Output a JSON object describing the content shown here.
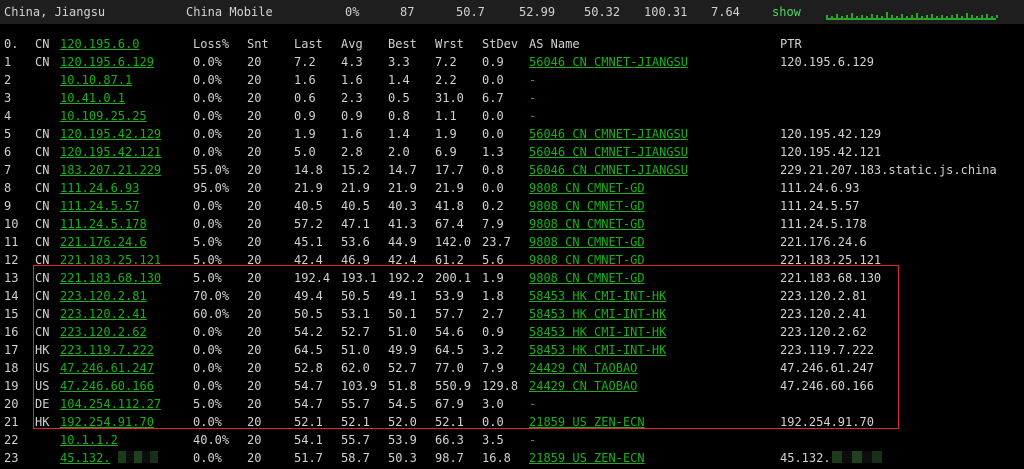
{
  "header": {
    "location": "China, Jiangsu",
    "isp": "China Mobile",
    "loss": "0%",
    "sent": "87",
    "last": "50.7",
    "avg": "52.99",
    "best": "50.32",
    "worst": "100.31",
    "stdev": "7.64",
    "show_label": "show"
  },
  "columns": {
    "hop": "0.",
    "cc": "CN",
    "ip": "120.195.6.0",
    "loss": "Loss%",
    "snt": "Snt",
    "last": "Last",
    "avg": "Avg",
    "best": "Best",
    "wrst": "Wrst",
    "stdev": "StDev",
    "asname": "AS Name",
    "ptr": "PTR"
  },
  "hops": [
    {
      "n": "1",
      "cc": "CN",
      "ip": "120.195.6.129",
      "loss": "0.0%",
      "snt": "20",
      "last": "7.2",
      "avg": "4.3",
      "best": "3.3",
      "wrst": "7.2",
      "stdev": "0.9",
      "asn": "56046",
      "ascc": "CN",
      "asname": "CMNET-JIANGSU",
      "ptr": "120.195.6.129"
    },
    {
      "n": "2",
      "cc": "",
      "ip": "10.10.87.1",
      "loss": "0.0%",
      "snt": "20",
      "last": "1.6",
      "avg": "1.6",
      "best": "1.4",
      "wrst": "2.2",
      "stdev": "0.0",
      "asn": "-",
      "ascc": "",
      "asname": "",
      "ptr": ""
    },
    {
      "n": "3",
      "cc": "",
      "ip": "10.41.0.1",
      "loss": "0.0%",
      "snt": "20",
      "last": "0.6",
      "avg": "2.3",
      "best": "0.5",
      "wrst": "31.0",
      "stdev": "6.7",
      "asn": "-",
      "ascc": "",
      "asname": "",
      "ptr": ""
    },
    {
      "n": "4",
      "cc": "",
      "ip": "10.109.25.25",
      "loss": "0.0%",
      "snt": "20",
      "last": "0.9",
      "avg": "0.9",
      "best": "0.8",
      "wrst": "1.1",
      "stdev": "0.0",
      "asn": "-",
      "ascc": "",
      "asname": "",
      "ptr": ""
    },
    {
      "n": "5",
      "cc": "CN",
      "ip": "120.195.42.129",
      "loss": "0.0%",
      "snt": "20",
      "last": "1.9",
      "avg": "1.6",
      "best": "1.4",
      "wrst": "1.9",
      "stdev": "0.0",
      "asn": "56046",
      "ascc": "CN",
      "asname": "CMNET-JIANGSU",
      "ptr": "120.195.42.129"
    },
    {
      "n": "6",
      "cc": "CN",
      "ip": "120.195.42.121",
      "loss": "0.0%",
      "snt": "20",
      "last": "5.0",
      "avg": "2.8",
      "best": "2.0",
      "wrst": "6.9",
      "stdev": "1.3",
      "asn": "56046",
      "ascc": "CN",
      "asname": "CMNET-JIANGSU",
      "ptr": "120.195.42.121"
    },
    {
      "n": "7",
      "cc": "CN",
      "ip": "183.207.21.229",
      "loss": "55.0%",
      "snt": "20",
      "last": "14.8",
      "avg": "15.2",
      "best": "14.7",
      "wrst": "17.7",
      "stdev": "0.8",
      "asn": "56046",
      "ascc": "CN",
      "asname": "CMNET-JIANGSU",
      "ptr": "229.21.207.183.static.js.china"
    },
    {
      "n": "8",
      "cc": "CN",
      "ip": "111.24.6.93",
      "loss": "95.0%",
      "snt": "20",
      "last": "21.9",
      "avg": "21.9",
      "best": "21.9",
      "wrst": "21.9",
      "stdev": "0.0",
      "asn": "9808",
      "ascc": "CN",
      "asname": "CMNET-GD",
      "ptr": "111.24.6.93"
    },
    {
      "n": "9",
      "cc": "CN",
      "ip": "111.24.5.57",
      "loss": "0.0%",
      "snt": "20",
      "last": "40.5",
      "avg": "40.5",
      "best": "40.3",
      "wrst": "41.8",
      "stdev": "0.2",
      "asn": "9808",
      "ascc": "CN",
      "asname": "CMNET-GD",
      "ptr": "111.24.5.57"
    },
    {
      "n": "10",
      "cc": "CN",
      "ip": "111.24.5.178",
      "loss": "0.0%",
      "snt": "20",
      "last": "57.2",
      "avg": "47.1",
      "best": "41.3",
      "wrst": "67.4",
      "stdev": "7.9",
      "asn": "9808",
      "ascc": "CN",
      "asname": "CMNET-GD",
      "ptr": "111.24.5.178"
    },
    {
      "n": "11",
      "cc": "CN",
      "ip": "221.176.24.6",
      "loss": "5.0%",
      "snt": "20",
      "last": "45.1",
      "avg": "53.6",
      "best": "44.9",
      "wrst": "142.0",
      "stdev": "23.7",
      "asn": "9808",
      "ascc": "CN",
      "asname": "CMNET-GD",
      "ptr": "221.176.24.6"
    },
    {
      "n": "12",
      "cc": "CN",
      "ip": "221.183.25.121",
      "loss": "5.0%",
      "snt": "20",
      "last": "42.4",
      "avg": "46.9",
      "best": "42.4",
      "wrst": "61.2",
      "stdev": "5.6",
      "asn": "9808",
      "ascc": "CN",
      "asname": "CMNET-GD",
      "ptr": "221.183.25.121"
    },
    {
      "n": "13",
      "cc": "CN",
      "ip": "221.183.68.130",
      "loss": "5.0%",
      "snt": "20",
      "last": "192.4",
      "avg": "193.1",
      "best": "192.2",
      "wrst": "200.1",
      "stdev": "1.9",
      "asn": "9808",
      "ascc": "CN",
      "asname": "CMNET-GD",
      "ptr": "221.183.68.130"
    },
    {
      "n": "14",
      "cc": "CN",
      "ip": "223.120.2.81",
      "loss": "70.0%",
      "snt": "20",
      "last": "49.4",
      "avg": "50.5",
      "best": "49.1",
      "wrst": "53.9",
      "stdev": "1.8",
      "asn": "58453",
      "ascc": "HK",
      "asname": "CMI-INT-HK",
      "ptr": "223.120.2.81"
    },
    {
      "n": "15",
      "cc": "CN",
      "ip": "223.120.2.41",
      "loss": "60.0%",
      "snt": "20",
      "last": "50.5",
      "avg": "53.1",
      "best": "50.1",
      "wrst": "57.7",
      "stdev": "2.7",
      "asn": "58453",
      "ascc": "HK",
      "asname": "CMI-INT-HK",
      "ptr": "223.120.2.41"
    },
    {
      "n": "16",
      "cc": "CN",
      "ip": "223.120.2.62",
      "loss": "0.0%",
      "snt": "20",
      "last": "54.2",
      "avg": "52.7",
      "best": "51.0",
      "wrst": "54.6",
      "stdev": "0.9",
      "asn": "58453",
      "ascc": "HK",
      "asname": "CMI-INT-HK",
      "ptr": "223.120.2.62"
    },
    {
      "n": "17",
      "cc": "HK",
      "ip": "223.119.7.222",
      "loss": "0.0%",
      "snt": "20",
      "last": "64.5",
      "avg": "51.0",
      "best": "49.9",
      "wrst": "64.5",
      "stdev": "3.2",
      "asn": "58453",
      "ascc": "HK",
      "asname": "CMI-INT-HK",
      "ptr": "223.119.7.222"
    },
    {
      "n": "18",
      "cc": "US",
      "ip": "47.246.61.247",
      "loss": "0.0%",
      "snt": "20",
      "last": "52.8",
      "avg": "62.0",
      "best": "52.7",
      "wrst": "77.0",
      "stdev": "7.9",
      "asn": "24429",
      "ascc": "CN",
      "asname": "TAOBAO",
      "ptr": "47.246.61.247"
    },
    {
      "n": "19",
      "cc": "US",
      "ip": "47.246.60.166",
      "loss": "0.0%",
      "snt": "20",
      "last": "54.7",
      "avg": "103.9",
      "best": "51.8",
      "wrst": "550.9",
      "stdev": "129.8",
      "asn": "24429",
      "ascc": "CN",
      "asname": "TAOBAO",
      "ptr": "47.246.60.166"
    },
    {
      "n": "20",
      "cc": "DE",
      "ip": "104.254.112.27",
      "loss": "5.0%",
      "snt": "20",
      "last": "54.7",
      "avg": "55.7",
      "best": "54.5",
      "wrst": "67.9",
      "stdev": "3.0",
      "asn": "-",
      "ascc": "",
      "asname": "",
      "ptr": ""
    },
    {
      "n": "21",
      "cc": "HK",
      "ip": "192.254.91.70",
      "loss": "0.0%",
      "snt": "20",
      "last": "52.1",
      "avg": "52.1",
      "best": "52.0",
      "wrst": "52.1",
      "stdev": "0.0",
      "asn": "21859",
      "ascc": "US",
      "asname": "ZEN-ECN",
      "ptr": "192.254.91.70"
    },
    {
      "n": "22",
      "cc": "",
      "ip": "10.1.1.2",
      "loss": "40.0%",
      "snt": "20",
      "last": "54.1",
      "avg": "55.7",
      "best": "53.9",
      "wrst": "66.3",
      "stdev": "3.5",
      "asn": "-",
      "ascc": "",
      "asname": "",
      "ptr": ""
    },
    {
      "n": "23",
      "cc": "",
      "ip": "45.132.",
      "loss": "0.0%",
      "snt": "20",
      "last": "51.7",
      "avg": "58.7",
      "best": "50.3",
      "wrst": "98.7",
      "stdev": "16.8",
      "asn": "21859",
      "ascc": "US",
      "asname": "ZEN-ECN",
      "ptr": "45.132.",
      "redacted": true
    }
  ],
  "colors": {
    "background": "#000000",
    "header": "#1e1e1e",
    "text": "#d2d2d2",
    "accent": "#18b218",
    "highlight": "#e02626"
  }
}
